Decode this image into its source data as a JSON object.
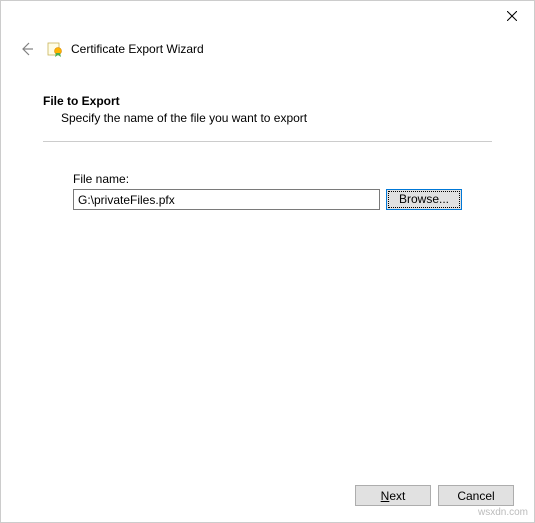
{
  "window": {
    "title": "Certificate Export Wizard"
  },
  "section": {
    "title": "File to Export",
    "description": "Specify the name of the file you want to export"
  },
  "field": {
    "label": "File name:",
    "value": "G:\\privateFiles.pfx",
    "browse": "Browse..."
  },
  "buttons": {
    "next_pre": "",
    "next_u": "N",
    "next_post": "ext",
    "cancel": "Cancel"
  },
  "watermark": "wsxdn.com"
}
